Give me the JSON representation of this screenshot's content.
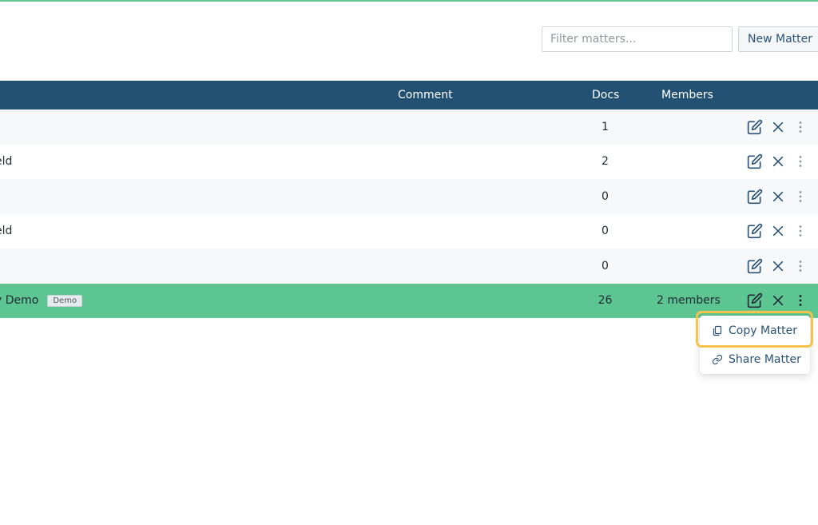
{
  "colors": {
    "accent": "#5cc592",
    "header_bg": "#225173",
    "primary_text": "#2a5377",
    "highlight": "#f5c24b"
  },
  "toolbar": {
    "filter_placeholder": "Filter matters...",
    "new_label": "New Matter"
  },
  "table": {
    "columns": {
      "comment": "Comment",
      "docs": "Docs",
      "members": "Members"
    },
    "rows": [
      {
        "name": "",
        "badge": "",
        "docs": "1",
        "members": ""
      },
      {
        "name": "eld",
        "badge": "",
        "docs": "2",
        "members": ""
      },
      {
        "name": "",
        "badge": "",
        "docs": "0",
        "members": ""
      },
      {
        "name": "eld",
        "badge": "",
        "docs": "0",
        "members": ""
      },
      {
        "name": "",
        "badge": "",
        "docs": "0",
        "members": ""
      },
      {
        "name": "y Demo",
        "badge": "Demo",
        "docs": "26",
        "members": "2 members"
      }
    ],
    "row_actions": [
      "edit-icon",
      "close-icon",
      "more-vertical-icon"
    ]
  },
  "menu": {
    "items": [
      {
        "label": "Copy Matter",
        "icon": "copy-icon"
      },
      {
        "label": "Share Matter",
        "icon": "link-icon"
      }
    ]
  }
}
